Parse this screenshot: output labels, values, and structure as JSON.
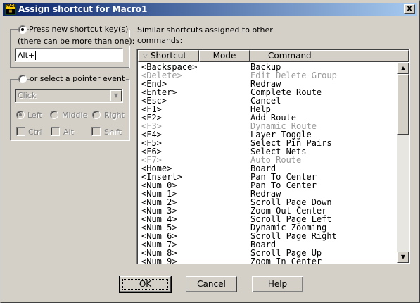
{
  "window": {
    "title": "Assign shortcut for Macro1",
    "close_label": "X"
  },
  "left_panel": {
    "shortcut_radio_label": "Press new shortcut key(s)",
    "shortcut_hint": "(there can be more than one):",
    "shortcut_value": "Alt+",
    "pointer_radio_label": "or select a pointer event",
    "pointer_event_selected": "Click",
    "mouse_buttons": [
      "Left",
      "Middle",
      "Right"
    ],
    "modifiers": [
      "Ctrl",
      "Alt",
      "Shift"
    ]
  },
  "similar": {
    "label_line1": "Similar shortcuts assigned to other",
    "label_line2": "commands:",
    "columns": [
      "Shortcut",
      "Mode",
      "Command"
    ],
    "rows": [
      {
        "shortcut": "<Backspace>",
        "command": "Backup",
        "enabled": true
      },
      {
        "shortcut": "<Delete>",
        "command": "Edit Delete Group",
        "enabled": false
      },
      {
        "shortcut": "<End>",
        "command": "Redraw",
        "enabled": true
      },
      {
        "shortcut": "<Enter>",
        "command": "Complete Route",
        "enabled": true
      },
      {
        "shortcut": "<Esc>",
        "command": "Cancel",
        "enabled": true
      },
      {
        "shortcut": "<F1>",
        "command": "Help",
        "enabled": true
      },
      {
        "shortcut": "<F2>",
        "command": "Add Route",
        "enabled": true
      },
      {
        "shortcut": "<F3>",
        "command": "Dynamic Route",
        "enabled": false
      },
      {
        "shortcut": "<F4>",
        "command": "Layer Toggle",
        "enabled": true
      },
      {
        "shortcut": "<F5>",
        "command": "Select Pin Pairs",
        "enabled": true
      },
      {
        "shortcut": "<F6>",
        "command": "Select Nets",
        "enabled": true
      },
      {
        "shortcut": "<F7>",
        "command": "Auto Route",
        "enabled": false
      },
      {
        "shortcut": "<Home>",
        "command": "Board",
        "enabled": true
      },
      {
        "shortcut": "<Insert>",
        "command": "Pan To Center",
        "enabled": true
      },
      {
        "shortcut": "<Num 0>",
        "command": "Pan To Center",
        "enabled": true
      },
      {
        "shortcut": "<Num 1>",
        "command": "Redraw",
        "enabled": true
      },
      {
        "shortcut": "<Num 2>",
        "command": "Scroll Page Down",
        "enabled": true
      },
      {
        "shortcut": "<Num 3>",
        "command": "Zoom Out Center",
        "enabled": true
      },
      {
        "shortcut": "<Num 4>",
        "command": "Scroll Page Left",
        "enabled": true
      },
      {
        "shortcut": "<Num 5>",
        "command": "Dynamic Zooming",
        "enabled": true
      },
      {
        "shortcut": "<Num 6>",
        "command": "Scroll Page Right",
        "enabled": true
      },
      {
        "shortcut": "<Num 7>",
        "command": "Board",
        "enabled": true
      },
      {
        "shortcut": "<Num 8>",
        "command": "Scroll Page Up",
        "enabled": true
      },
      {
        "shortcut": "<Num 9>",
        "command": "Zoom In Center",
        "enabled": true
      }
    ]
  },
  "buttons": {
    "ok": "OK",
    "cancel": "Cancel",
    "help": "Help"
  },
  "icons": {
    "app": "pads-app-icon",
    "close": "close-icon",
    "scroll_up": "scroll-up-icon",
    "scroll_down": "scroll-down-icon",
    "dropdown": "chevron-down-icon"
  }
}
